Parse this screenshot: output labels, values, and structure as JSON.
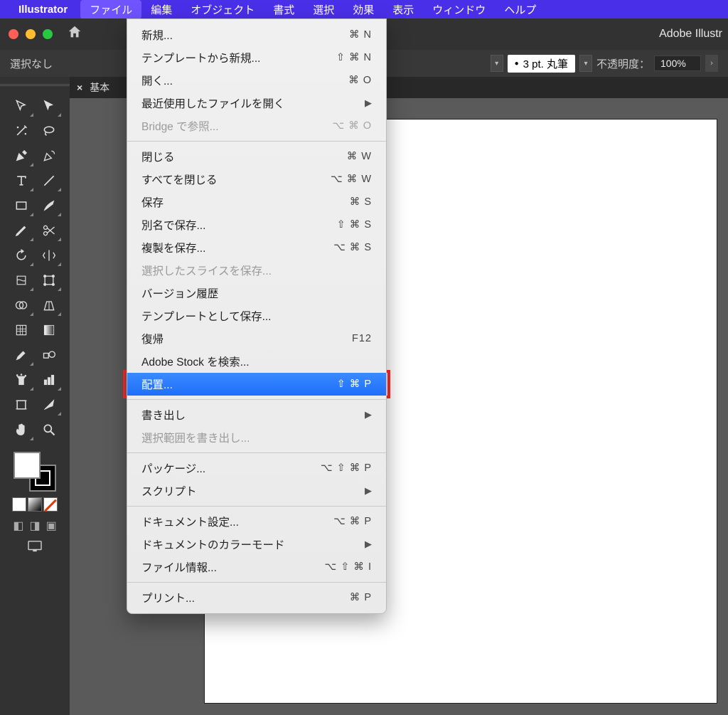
{
  "menubar": {
    "app": "Illustrator",
    "items": [
      "ファイル",
      "編集",
      "オブジェクト",
      "書式",
      "選択",
      "効果",
      "表示",
      "ウィンドウ",
      "ヘルプ"
    ]
  },
  "appbar": {
    "title": "Adobe Illustr"
  },
  "ctrl": {
    "selection": "選択なし",
    "brush": "3 pt. 丸筆",
    "opacity_label": "不透明度：",
    "opacity_value": "100%"
  },
  "tab": {
    "close": "×",
    "name": "基本"
  },
  "menu": {
    "groups": [
      [
        {
          "label": "新規...",
          "shortcut": "⌘ N"
        },
        {
          "label": "テンプレートから新規...",
          "shortcut": "⇧ ⌘ N"
        },
        {
          "label": "開く...",
          "shortcut": "⌘ O"
        },
        {
          "label": "最近使用したファイルを開く",
          "submenu": true
        },
        {
          "label": "Bridge で参照...",
          "shortcut": "⌥ ⌘ O",
          "disabled": true
        }
      ],
      [
        {
          "label": "閉じる",
          "shortcut": "⌘ W"
        },
        {
          "label": "すべてを閉じる",
          "shortcut": "⌥ ⌘ W"
        },
        {
          "label": "保存",
          "shortcut": "⌘ S"
        },
        {
          "label": "別名で保存...",
          "shortcut": "⇧ ⌘ S"
        },
        {
          "label": "複製を保存...",
          "shortcut": "⌥ ⌘ S"
        },
        {
          "label": "選択したスライスを保存...",
          "disabled": true
        },
        {
          "label": "バージョン履歴"
        },
        {
          "label": "テンプレートとして保存..."
        },
        {
          "label": "復帰",
          "shortcut": "F12"
        },
        {
          "label": "Adobe Stock を検索..."
        },
        {
          "label": "配置...",
          "shortcut": "⇧ ⌘ P",
          "selected": true,
          "highlight": true
        }
      ],
      [
        {
          "label": "書き出し",
          "submenu": true
        },
        {
          "label": "選択範囲を書き出し...",
          "disabled": true
        }
      ],
      [
        {
          "label": "パッケージ...",
          "shortcut": "⌥ ⇧ ⌘ P"
        },
        {
          "label": "スクリプト",
          "submenu": true
        }
      ],
      [
        {
          "label": "ドキュメント設定...",
          "shortcut": "⌥ ⌘ P"
        },
        {
          "label": "ドキュメントのカラーモード",
          "submenu": true
        },
        {
          "label": "ファイル情報...",
          "shortcut": "⌥ ⇧ ⌘ I"
        }
      ],
      [
        {
          "label": "プリント...",
          "shortcut": "⌘ P"
        }
      ]
    ]
  }
}
